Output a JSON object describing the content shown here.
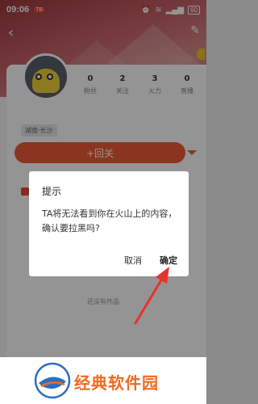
{
  "status_bar": {
    "time": "09:06",
    "notification_badge": "TB",
    "battery": "60"
  },
  "profile": {
    "stats": [
      {
        "value": "0",
        "label": "粉丝"
      },
      {
        "value": "2",
        "label": "关注"
      },
      {
        "value": "3",
        "label": "火力"
      },
      {
        "value": "0",
        "label": "直播"
      }
    ],
    "location": "湖南·长沙",
    "follow_back_label": "+回关",
    "empty_text": "还没有作品"
  },
  "dialog": {
    "title": "提示",
    "message": "TA将无法看到你在火山上的内容，确认要拉黑吗?",
    "cancel_label": "取消",
    "confirm_label": "确定"
  },
  "watermark": {
    "text": "经典软件园"
  },
  "colors": {
    "accent": "#f05a36",
    "arrow": "#e8322c",
    "watermark": "#f16a22"
  },
  "icons": [
    "back-arrow-icon",
    "edit-icon",
    "wifi-icon",
    "signal-icon",
    "battery-icon",
    "dropdown-arrow-icon",
    "pointer-arrow-icon"
  ]
}
